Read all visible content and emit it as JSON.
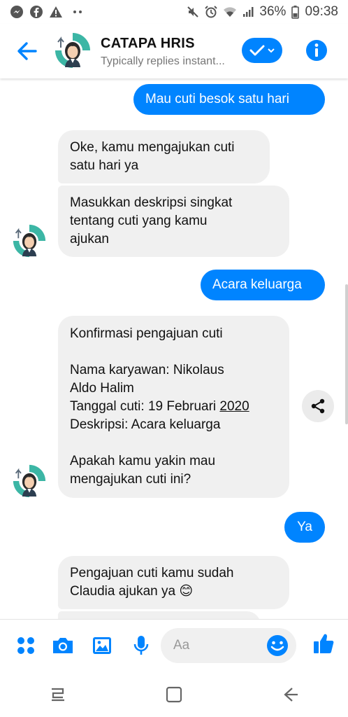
{
  "status_bar": {
    "battery": "36%",
    "time": "09:38",
    "left_icons": [
      "messenger-icon",
      "facebook-icon",
      "warning-icon",
      "more-dots-icon"
    ],
    "right_icons": [
      "mute-icon",
      "alarm-icon",
      "wifi-icon",
      "signal-icon",
      "battery-icon"
    ]
  },
  "header": {
    "title": "CATAPA HRIS",
    "subtitle": "Typically replies instant...",
    "accent": "#0084ff"
  },
  "messages": [
    {
      "id": "m1",
      "from": "user",
      "text": "Mau cuti besok satu hari"
    },
    {
      "id": "m2",
      "from": "bot",
      "text": "Oke, kamu mengajukan cuti\nsatu hari ya"
    },
    {
      "id": "m3",
      "from": "bot",
      "text": "Masukkan deskripsi singkat\ntentang cuti yang kamu\najukan"
    },
    {
      "id": "m4",
      "from": "user",
      "text": "Acara keluarga"
    },
    {
      "id": "m5",
      "from": "bot",
      "line1": "Konfirmasi pengajuan cuti",
      "line2": "Nama karyawan: Nikolaus\nAldo Halim",
      "line3_prefix": "Tanggal cuti: 19 Februari ",
      "line3_year": "2020",
      "line4": "Deskripsi: Acara keluarga",
      "line5": "Apakah kamu yakin mau\nmengajukan cuti ini?"
    },
    {
      "id": "m6",
      "from": "user",
      "text": "Ya"
    },
    {
      "id": "m7",
      "from": "bot",
      "text": "Pengajuan cuti kamu sudah\nClaudia ajukan ya",
      "emoji": "😊"
    }
  ],
  "composer": {
    "placeholder": "Aa",
    "icons": [
      "apps-icon",
      "camera-icon",
      "gallery-icon",
      "microphone-icon",
      "emoji-icon",
      "like-icon"
    ]
  },
  "colors": {
    "accent": "#0084ff",
    "incoming_bubble": "#f0f0f0",
    "avatar_teal": "#3cb6a5"
  }
}
